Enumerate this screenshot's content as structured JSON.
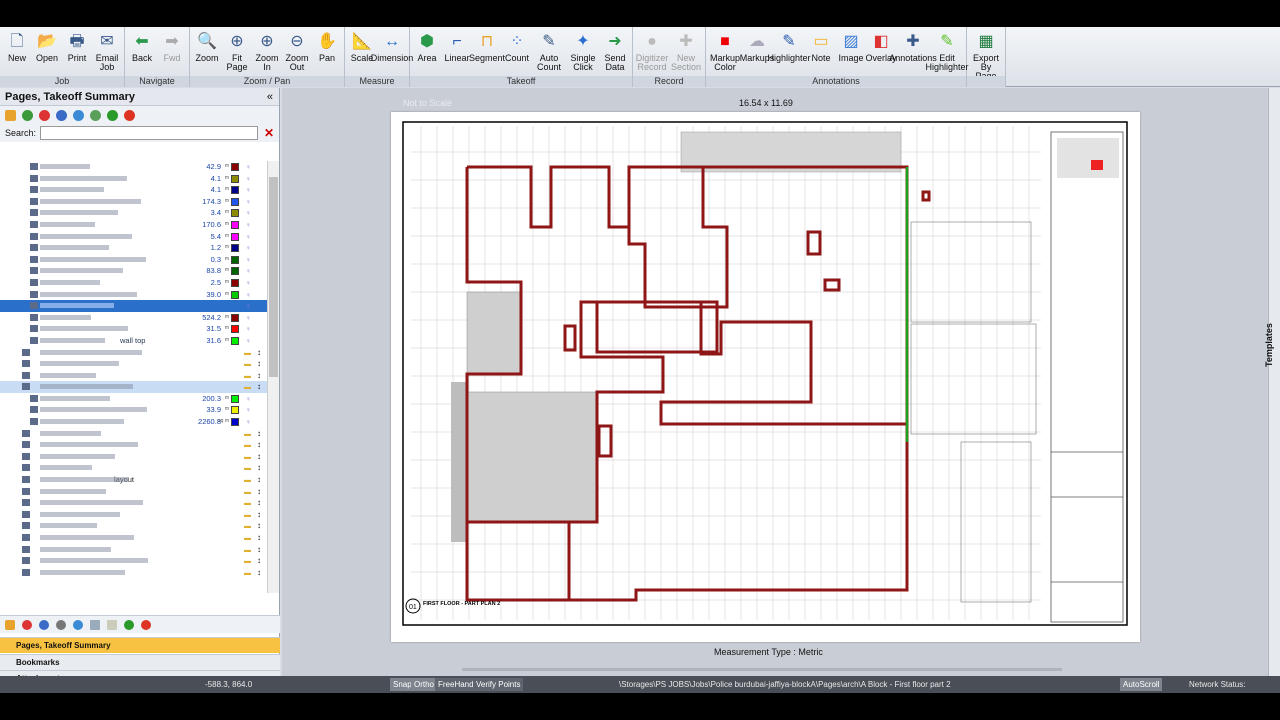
{
  "ribbon": {
    "groups": [
      {
        "label": "Job",
        "buttons": [
          {
            "label": "New",
            "icon": "new-doc-icon"
          },
          {
            "label": "Open",
            "icon": "folder-icon"
          },
          {
            "label": "Print",
            "icon": "printer-icon"
          },
          {
            "label": "Email\nJob",
            "icon": "email-icon"
          }
        ]
      },
      {
        "label": "Navigate",
        "buttons": [
          {
            "label": "Back",
            "icon": "arrow-left-icon"
          },
          {
            "label": "Fwd",
            "icon": "arrow-right-icon",
            "disabled": true
          }
        ]
      },
      {
        "label": "Zoom / Pan",
        "buttons": [
          {
            "label": "Zoom",
            "icon": "magnifier-icon"
          },
          {
            "label": "Fit\nPage",
            "icon": "fit-page-icon"
          },
          {
            "label": "Zoom\nIn",
            "icon": "zoom-in-icon"
          },
          {
            "label": "Zoom\nOut",
            "icon": "zoom-out-icon"
          },
          {
            "label": "Pan",
            "icon": "hand-icon"
          }
        ]
      },
      {
        "label": "Measure",
        "buttons": [
          {
            "label": "Scale",
            "icon": "scale-icon"
          },
          {
            "label": "Dimension",
            "icon": "dimension-icon"
          }
        ]
      },
      {
        "label": "Takeoff",
        "buttons": [
          {
            "label": "Area",
            "icon": "area-icon"
          },
          {
            "label": "Linear",
            "icon": "linear-icon"
          },
          {
            "label": "Segment",
            "icon": "segment-icon"
          },
          {
            "label": "Count",
            "icon": "count-icon"
          },
          {
            "label": "Auto\nCount",
            "icon": "auto-count-icon"
          },
          {
            "label": "Single\nClick",
            "icon": "single-click-icon"
          },
          {
            "label": "Send\nData",
            "icon": "send-data-icon"
          }
        ]
      },
      {
        "label": "Record",
        "buttons": [
          {
            "label": "Digitizer\nRecord",
            "icon": "digitizer-icon",
            "disabled": true
          },
          {
            "label": "New\nSection",
            "icon": "new-section-icon",
            "disabled": true
          }
        ]
      },
      {
        "label": "Annotations",
        "buttons": [
          {
            "label": "Markup\nColor",
            "icon": "markup-color-icon"
          },
          {
            "label": "Markups",
            "icon": "cloud-icon"
          },
          {
            "label": "Highlighter",
            "icon": "highlighter-icon"
          },
          {
            "label": "Note",
            "icon": "note-icon"
          },
          {
            "label": "Image",
            "icon": "image-icon"
          },
          {
            "label": "Overlay",
            "icon": "overlay-icon"
          },
          {
            "label": "Annotations",
            "icon": "annotations-icon"
          },
          {
            "label": "Edit\nHighlighter",
            "icon": "edit-highlighter-icon"
          }
        ]
      },
      {
        "label": "",
        "buttons": [
          {
            "label": "Export\nBy Page",
            "icon": "excel-export-icon"
          }
        ]
      }
    ]
  },
  "left_panel": {
    "title": "Pages, Takeoff Summary",
    "collapse": "«",
    "search_label": "Search:",
    "rows": [
      {
        "name": "",
        "value": "42.9",
        "unit": "m",
        "color": "#8b0000"
      },
      {
        "name": "",
        "value": "4.1",
        "unit": "m",
        "color": "#8b8b00"
      },
      {
        "name": "",
        "value": "4.1",
        "unit": "m",
        "color": "#00008b"
      },
      {
        "name": "",
        "value": "174.3",
        "unit": "m",
        "color": "#2255ee"
      },
      {
        "name": "",
        "value": "3.4",
        "unit": "m",
        "color": "#8b8b00"
      },
      {
        "name": "",
        "value": "170.6",
        "unit": "m",
        "color": "#ff00ff"
      },
      {
        "name": "",
        "value": "5.4",
        "unit": "m",
        "color": "#ff00ff"
      },
      {
        "name": "",
        "value": "1.2",
        "unit": "m",
        "color": "#00008b"
      },
      {
        "name": "",
        "value": "0.3",
        "unit": "m",
        "color": "#006400"
      },
      {
        "name": "",
        "value": "83.8",
        "unit": "m",
        "color": "#006400"
      },
      {
        "name": "",
        "value": "2.5",
        "unit": "m",
        "color": "#8b0000"
      },
      {
        "name": "",
        "value": "39.0",
        "unit": "m",
        "color": "#00cc00"
      },
      {
        "name": "",
        "value": "",
        "unit": "",
        "color": "",
        "selected": true
      },
      {
        "name": "",
        "value": "524.2",
        "unit": "m",
        "color": "#8b0000"
      },
      {
        "name": "",
        "value": "31.5",
        "unit": "m",
        "color": "#ff0000"
      },
      {
        "name": "wall top",
        "value": "31.6",
        "unit": "m",
        "color": "#00ee00"
      },
      {
        "name": "",
        "value": "",
        "group": true
      },
      {
        "name": "",
        "value": "",
        "group": true
      },
      {
        "name": "",
        "value": "",
        "group": true
      },
      {
        "name": "",
        "value": "",
        "group": true,
        "selected2": true
      },
      {
        "name": "",
        "value": "200.3",
        "unit": "m",
        "color": "#00ee00"
      },
      {
        "name": "",
        "value": "33.9",
        "unit": "m",
        "color": "#eeee00"
      },
      {
        "name": "",
        "value": "2260.8",
        "unit": "sq m",
        "color": "#0000cc"
      },
      {
        "name": "",
        "value": "",
        "group": true
      },
      {
        "name": "",
        "value": "",
        "group": true
      },
      {
        "name": "",
        "value": "",
        "group": true
      },
      {
        "name": "",
        "value": "",
        "group": true
      },
      {
        "name": "layout",
        "value": "",
        "group": true
      },
      {
        "name": "",
        "value": "",
        "group": true
      },
      {
        "name": "",
        "value": "",
        "group": true
      },
      {
        "name": "",
        "value": "",
        "group": true
      },
      {
        "name": "",
        "value": "",
        "group": true
      },
      {
        "name": "",
        "value": "",
        "group": true
      },
      {
        "name": "",
        "value": "",
        "group": true
      },
      {
        "name": "",
        "value": "",
        "group": true
      },
      {
        "name": "",
        "value": "",
        "group": true
      }
    ],
    "accordion": [
      "Pages, Takeoff Summary",
      "Bookmarks",
      "Attachments"
    ]
  },
  "canvas": {
    "page_size": "16.54 x 11.69",
    "not_to_scale": "Not to Scale",
    "measurement_type": "Measurement Type : Metric",
    "drawing_title": "FIRST FLOOR - PART PLAN 2",
    "drawing_number": "01"
  },
  "right_strip": {
    "label": "Templates"
  },
  "status": {
    "coords": "-588.3, 864.0",
    "snap": "Snap",
    "ortho": "Ortho",
    "freehand": "FreeHand",
    "verify": "Verify Points",
    "path": "\\Storages\\PS JOBS\\Jobs\\Police burdubai-jaffiya-blockA\\Pages\\arch\\A Block - First floor part 2",
    "autoscroll": "AutoScroll",
    "network": "Network Status: Connected"
  }
}
